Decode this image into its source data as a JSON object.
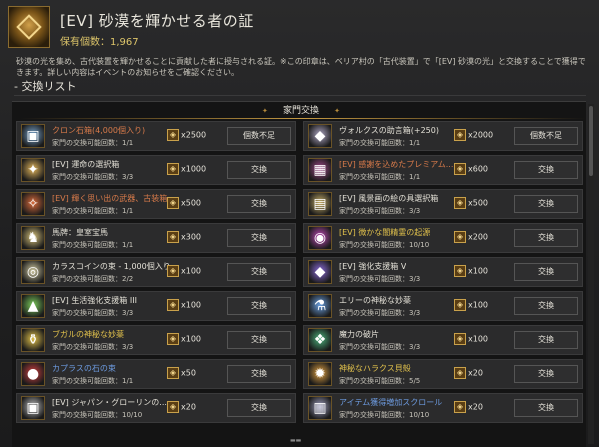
{
  "header": {
    "title": "[EV] 砂漠を輝かせる者の証",
    "hold_label": "保有個数：",
    "hold_count": "1,967"
  },
  "description": {
    "text": "砂漠の光を集め、古代装置を輝かせることに貢献した者に授与される証。※この印章は、ベリア村の「古代装置」で「[EV] 砂漠の光」と交換することで獲得できます。詳しい内容はイベントのお知らせをご確認ください。"
  },
  "section": {
    "title": "- 交換リスト"
  },
  "tab": {
    "label": "家門交換"
  },
  "limit_label": "家門の交換可能回数：",
  "items": [
    {
      "name": "クロン石箱(4,000個入り)",
      "name_color": "orange",
      "limit": "1/1",
      "cost": "x2500",
      "btn": "個数不足",
      "icon": "chest-icon",
      "icon_glyph": "▣",
      "icon_color": "#7aa7d0"
    },
    {
      "name": "ヴォルクスの助言箱(+250)",
      "name_color": "white",
      "limit": "1/1",
      "cost": "x2000",
      "btn": "個数不足",
      "icon": "advice-box-icon",
      "icon_glyph": "◆",
      "icon_color": "#b0a8c6"
    },
    {
      "name": "[EV] 運命の選択箱",
      "name_color": "white",
      "limit": "3/3",
      "cost": "x1000",
      "btn": "交換",
      "icon": "fate-box-icon",
      "icon_glyph": "✦",
      "icon_color": "#e1b45a"
    },
    {
      "name": "[EV] 感謝を込めたプレミアム...",
      "name_color": "orange",
      "limit": "1/1",
      "cost": "x600",
      "btn": "交換",
      "icon": "premium-box-icon",
      "icon_glyph": "▦",
      "icon_color": "#a04a8a"
    },
    {
      "name": "[EV] 輝く思い出の武器、古装箱",
      "name_color": "orange",
      "limit": "1/1",
      "cost": "x500",
      "btn": "交換",
      "icon": "weapon-box-icon",
      "icon_glyph": "✧",
      "icon_color": "#d96a3a"
    },
    {
      "name": "[EV] 風景画の絵の具選択箱",
      "name_color": "white",
      "limit": "3/3",
      "cost": "x500",
      "btn": "交換",
      "icon": "paint-box-icon",
      "icon_glyph": "▤",
      "icon_color": "#c8b06a"
    },
    {
      "name": "馬牌：皇室宝馬",
      "name_color": "white",
      "limit": "1/1",
      "cost": "x300",
      "btn": "交換",
      "icon": "horse-token-icon",
      "icon_glyph": "♞",
      "icon_color": "#d8c37a"
    },
    {
      "name": "[EV] 微かな闇精霊の起源",
      "name_color": "yellow",
      "limit": "10/10",
      "cost": "x200",
      "btn": "交換",
      "icon": "dark-spirit-icon",
      "icon_glyph": "◉",
      "icon_color": "#c04ab8"
    },
    {
      "name": "カラスコインの束 - 1,000個入り",
      "name_color": "white",
      "limit": "2/2",
      "cost": "x100",
      "btn": "交換",
      "icon": "coin-bundle-icon",
      "icon_glyph": "◎",
      "icon_color": "#cfc8a0"
    },
    {
      "name": "[EV] 強化支援箱 V",
      "name_color": "white",
      "limit": "3/3",
      "cost": "x100",
      "btn": "交換",
      "icon": "enhance-box-v-icon",
      "icon_glyph": "◆",
      "icon_color": "#8a6ad8"
    },
    {
      "name": "[EV] 生活強化支援箱 III",
      "name_color": "white",
      "limit": "3/3",
      "cost": "x100",
      "btn": "交換",
      "icon": "life-box-icon",
      "icon_glyph": "▲",
      "icon_color": "#7acb5a"
    },
    {
      "name": "エリーの神秘な妙薬",
      "name_color": "white",
      "limit": "3/3",
      "cost": "x100",
      "btn": "交換",
      "icon": "elixir-icon",
      "icon_glyph": "⚗",
      "icon_color": "#6aa0e0"
    },
    {
      "name": "ブガルの神秘な妙薬",
      "name_color": "yellow",
      "limit": "3/3",
      "cost": "x100",
      "btn": "交換",
      "icon": "bugal-elixir-icon",
      "icon_glyph": "⚱",
      "icon_color": "#e0c04a"
    },
    {
      "name": "魔力の破片",
      "name_color": "white",
      "limit": "3/3",
      "cost": "x100",
      "btn": "交換",
      "icon": "magic-shard-icon",
      "icon_glyph": "❖",
      "icon_color": "#4ab07a"
    },
    {
      "name": "カプラスの石の束",
      "name_color": "blue",
      "limit": "1/1",
      "cost": "x50",
      "btn": "交換",
      "icon": "caphras-icon",
      "icon_glyph": "●",
      "icon_color": "#d04040"
    },
    {
      "name": "神秘なハラクス貝殻",
      "name_color": "yellow",
      "limit": "5/5",
      "cost": "x20",
      "btn": "交換",
      "icon": "shell-icon",
      "icon_glyph": "✹",
      "icon_color": "#e0a040"
    },
    {
      "name": "[EV] ジャパン・グローリンの...",
      "name_color": "white",
      "limit": "10/10",
      "cost": "x20",
      "btn": "交換",
      "icon": "japan-box-icon",
      "icon_glyph": "▣",
      "icon_color": "#c0c0c0"
    },
    {
      "name": "アイテム獲得増加スクロール",
      "name_color": "blue",
      "limit": "10/10",
      "cost": "x20",
      "btn": "交換",
      "icon": "scroll-icon",
      "icon_glyph": "▥",
      "icon_color": "#a0a0c0"
    }
  ],
  "colors": {
    "name_orange": "#d77a4a",
    "name_white": "#e3e0d6",
    "name_yellow": "#e2c24c",
    "name_blue": "#6d9be0",
    "coin": "#c9a14b"
  }
}
